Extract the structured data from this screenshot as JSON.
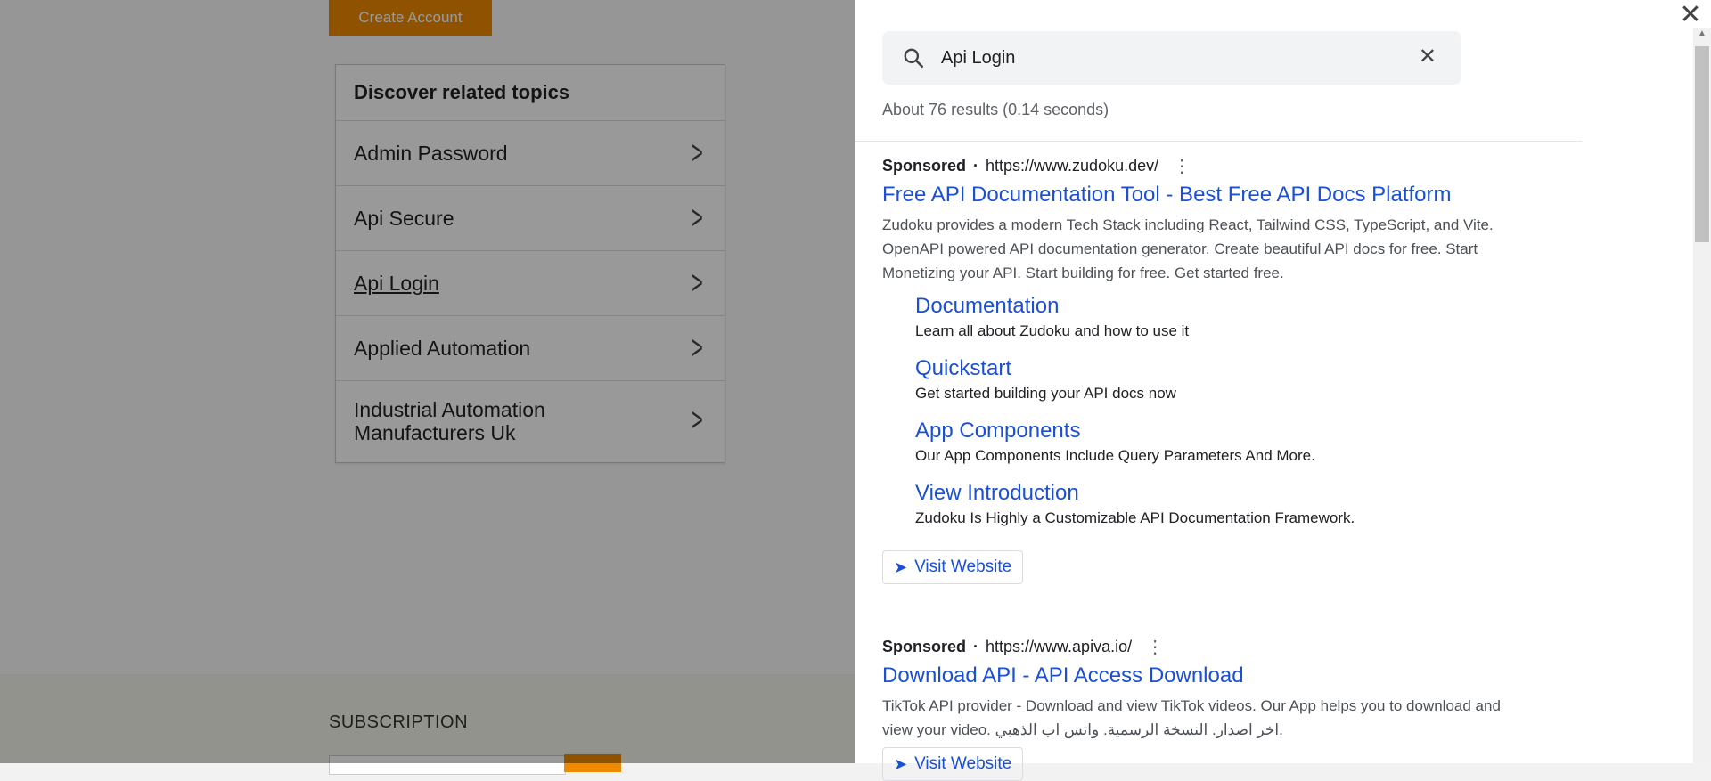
{
  "background": {
    "create_account": "Create Account",
    "topics_title": "Discover related topics",
    "topics": [
      {
        "label": "Admin Password"
      },
      {
        "label": "Api Secure"
      },
      {
        "label": "Api Login"
      },
      {
        "label": "Applied Automation"
      },
      {
        "label": "Industrial Automation Manufacturers Uk"
      }
    ],
    "subscription": "SUBSCRIPTION"
  },
  "panel": {
    "search_value": "Api Login",
    "stats": "About 76 results (0.14 seconds)",
    "ads": [
      {
        "sponsored": "Sponsored",
        "url": "https://www.zudoku.dev/",
        "title": "Free API Documentation Tool - Best Free API Docs Platform",
        "description": "Zudoku provides a modern Tech Stack including React, Tailwind CSS, TypeScript, and Vite. OpenAPI powered API documentation generator. Create beautiful API docs for free. Start Monetizing your API. Start building for free. Get started free.",
        "sitelinks": [
          {
            "title": "Documentation",
            "desc": "Learn all about Zudoku and how to use it"
          },
          {
            "title": "Quickstart",
            "desc": "Get started building your API docs now"
          },
          {
            "title": "App Components",
            "desc": "Our App Components Include Query Parameters And More."
          },
          {
            "title": "View Introduction",
            "desc": "Zudoku Is Highly a Customizable API Documentation Framework."
          }
        ],
        "visit": "Visit Website"
      },
      {
        "sponsored": "Sponsored",
        "url": "https://www.apiva.io/",
        "title": "Download API - API Access Download",
        "description": "TikTok API provider - Download and view TikTok videos. Our App helps you to download and view your video. اخر اصدار. النسخة الرسمية. واتس اب الذهبي.",
        "visit": "Visit Website"
      }
    ]
  },
  "colors": {
    "accent": "#ee8a00",
    "link": "#1a4fd6"
  }
}
